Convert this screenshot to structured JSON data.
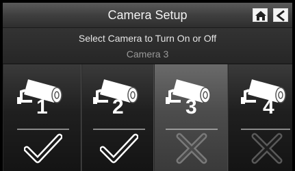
{
  "header": {
    "title": "Camera Setup",
    "home_icon": "home-icon",
    "back_icon": "back-arrow-icon"
  },
  "info": {
    "instruction": "Select Camera to Turn On or Off",
    "selected_camera": "Camera 3"
  },
  "cameras": [
    {
      "number": "1",
      "status": "on",
      "status_icon": "checkmark-icon"
    },
    {
      "number": "2",
      "status": "on",
      "status_icon": "checkmark-icon"
    },
    {
      "number": "3",
      "status": "off",
      "status_icon": "x-icon",
      "selected": true
    },
    {
      "number": "4",
      "status": "off",
      "status_icon": "x-icon"
    }
  ],
  "colors": {
    "on_mark": "#ffffff",
    "off_mark": "#6e6e6e"
  }
}
